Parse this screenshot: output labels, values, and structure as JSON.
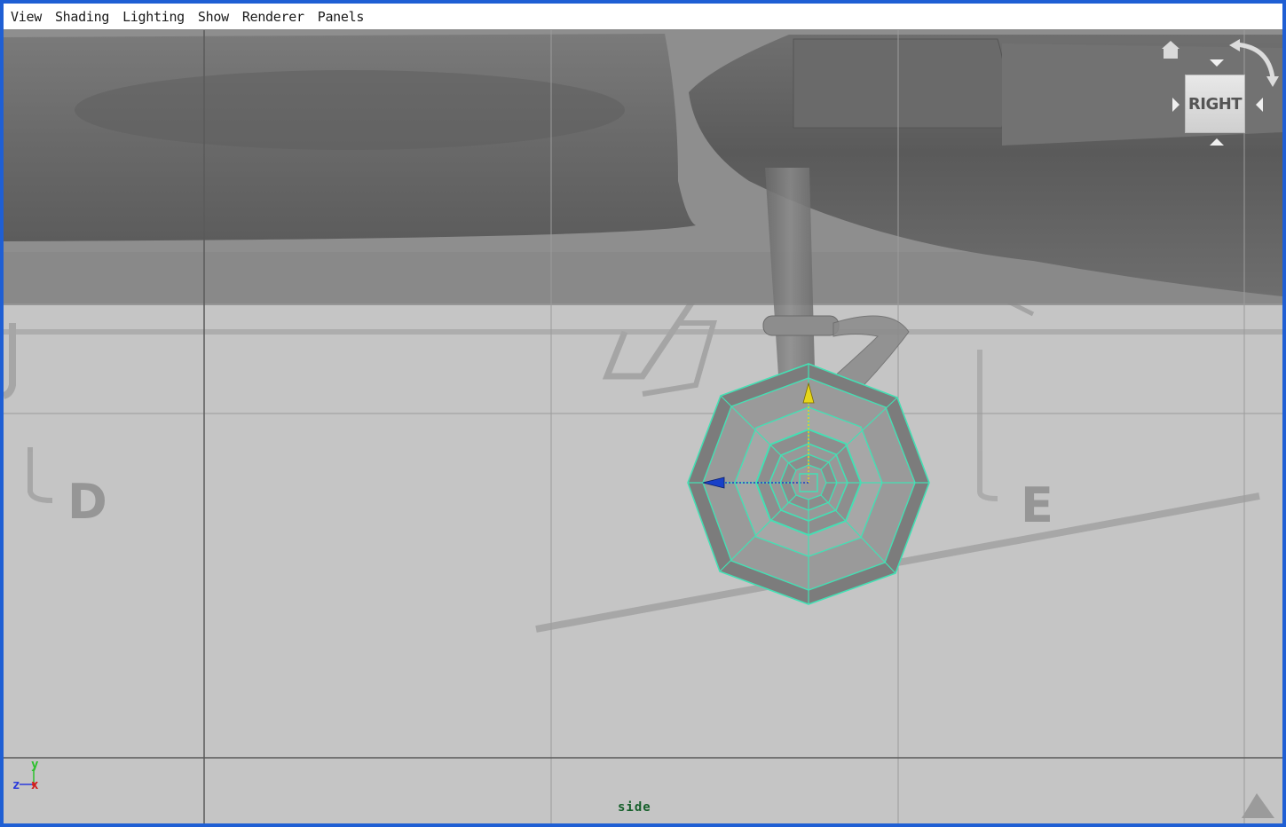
{
  "menubar": {
    "items": [
      "View",
      "Shading",
      "Lighting",
      "Show",
      "Renderer",
      "Panels"
    ]
  },
  "viewport": {
    "label": "side",
    "background_labels": [
      "D",
      "E"
    ]
  },
  "viewcube": {
    "face_label": "RIGHT",
    "icons": [
      "home-icon",
      "rotate-arrow-icon",
      "arrow-up-icon",
      "arrow-down-icon",
      "arrow-left-icon",
      "arrow-right-icon"
    ]
  },
  "axis_indicator": {
    "y": "y",
    "z": "z",
    "x": "x"
  },
  "colors": {
    "frame_border": "#1f5fd4",
    "viewport_bg": "#c5c5c5",
    "selection_wire": "#44e0b4",
    "manip_y": "#e6d61a",
    "manip_z": "#1840c8",
    "label_green": "#155f2a"
  }
}
